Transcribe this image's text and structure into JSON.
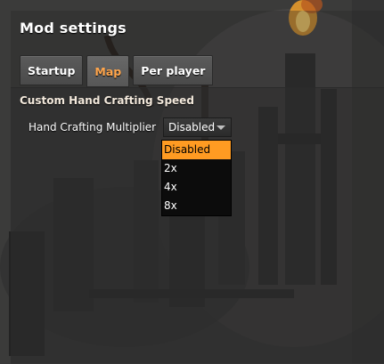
{
  "window": {
    "title": "Mod settings"
  },
  "tabs": [
    {
      "label": "Startup",
      "active": false
    },
    {
      "label": "Map",
      "active": true
    },
    {
      "label": "Per player",
      "active": false
    }
  ],
  "section": {
    "title": "Custom Hand Crafting Speed",
    "setting_label": "Hand Crafting Multiplier",
    "selected_value": "Disabled",
    "options": [
      "Disabled",
      "2x",
      "4x",
      "8x"
    ],
    "highlighted_option": "Disabled"
  },
  "colors": {
    "active_tab": "#ffa64d",
    "highlight": "#ff9b22",
    "dropdown_bg": "#0c0c0c"
  }
}
